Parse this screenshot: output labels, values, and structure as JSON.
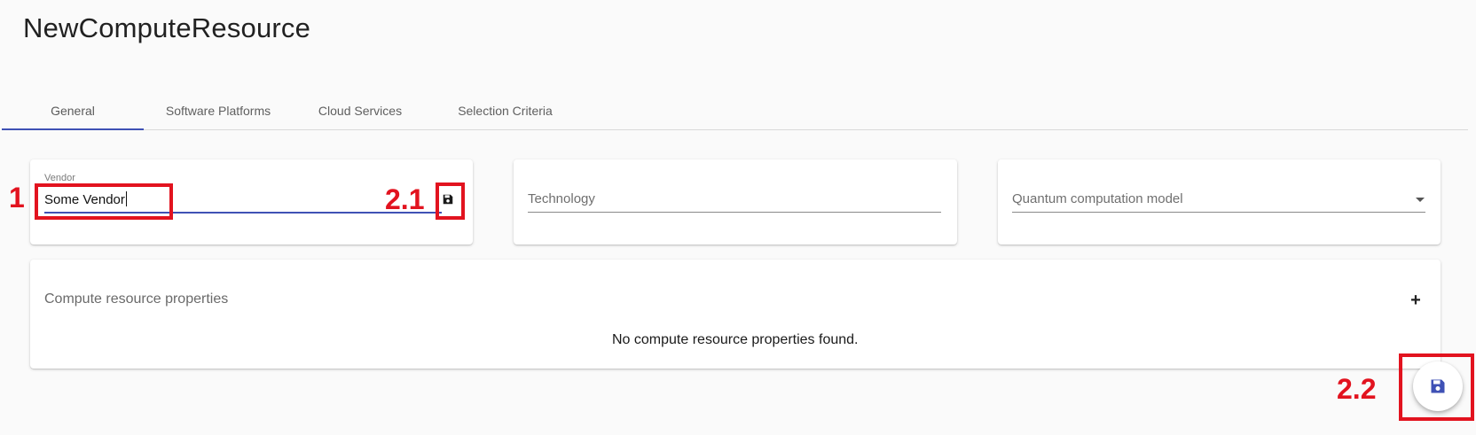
{
  "page": {
    "title": "NewComputeResource"
  },
  "tabs": [
    {
      "label": "General",
      "active": true
    },
    {
      "label": "Software Platforms",
      "active": false
    },
    {
      "label": "Cloud Services",
      "active": false
    },
    {
      "label": "Selection Criteria",
      "active": false
    }
  ],
  "vendor_field": {
    "label": "Vendor",
    "value": "Some Vendor",
    "save_icon": "floppy-disk-icon"
  },
  "technology_field": {
    "placeholder": "Technology",
    "value": ""
  },
  "model_field": {
    "placeholder": "Quantum computation model",
    "value": "",
    "dropdown_icon": "caret-down-icon"
  },
  "properties": {
    "title": "Compute resource properties",
    "add_label": "+",
    "empty_message": "No compute resource properties found."
  },
  "fab": {
    "icon": "floppy-disk-icon"
  },
  "annotations": {
    "label_1": "1",
    "label_2_1": "2.1",
    "label_2_2": "2.2"
  },
  "colors": {
    "accent": "#3f51b5",
    "annotation": "#e2131f",
    "background": "#fafafa"
  }
}
